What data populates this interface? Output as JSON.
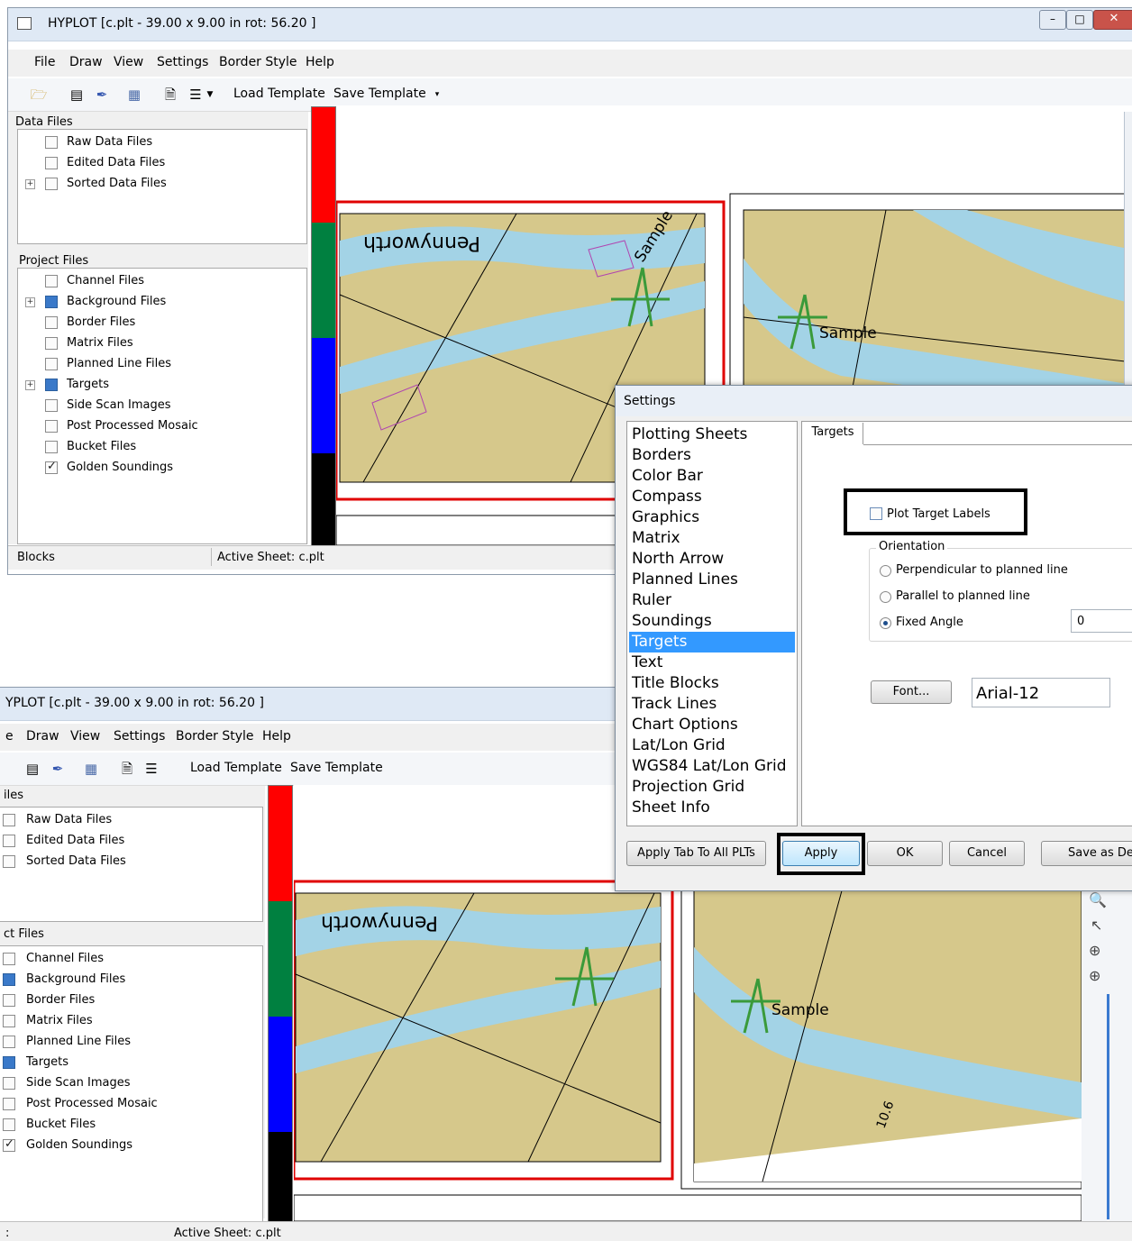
{
  "window": {
    "title": "HYPLOT [c.plt - 39.00 x 9.00 in  rot: 56.20 ]",
    "menu": [
      "File",
      "Draw",
      "View",
      "Settings",
      "Border Style",
      "Help"
    ],
    "toolbar": {
      "load_template": "Load Template",
      "save_template": "Save Template"
    },
    "data_files_title": "Data Files",
    "data_files": [
      "Raw Data Files",
      "Edited Data Files",
      "Sorted Data Files"
    ],
    "project_files_title": "Project Files",
    "project_files": [
      "Channel Files",
      "Background Files",
      "Border Files",
      "Matrix Files",
      "Planned Line Files",
      "Targets",
      "Side Scan Images",
      "Post Processed Mosaic",
      "Bucket Files",
      "Golden Soundings"
    ],
    "status_blocks": "Blocks",
    "status_active_sheet": "Active Sheet: c.plt"
  },
  "window2": {
    "title": "YPLOT [c.plt - 39.00 x 9.00 in  rot: 56.20 ]",
    "menu": [
      "e",
      "Draw",
      "View",
      "Settings",
      "Border Style",
      "Help"
    ],
    "data_files_title": "iles",
    "project_files_title": "ct Files",
    "status_left": ":",
    "status_active_sheet": "Active Sheet: c.plt"
  },
  "map": {
    "label_penny": "Pennyworth",
    "label_sample": "Sample",
    "sounding": "10.6"
  },
  "settings_dialog": {
    "title": "Settings",
    "categories": [
      "Plotting Sheets",
      "Borders",
      "Color Bar",
      "Compass",
      "Graphics",
      "Matrix",
      "North Arrow",
      "Planned Lines",
      "Ruler",
      "Soundings",
      "Targets",
      "Text",
      "Title Blocks",
      "Track Lines",
      "Chart Options",
      "Lat/Lon Grid",
      "WGS84 Lat/Lon Grid",
      "Projection Grid",
      "Sheet Info"
    ],
    "selected_category": "Targets",
    "tab_label": "Targets",
    "plot_target_labels": "Plot Target Labels",
    "orientation_label": "Orientation",
    "orientation_options": [
      "Perpendicular to planned line",
      "Parallel to planned line",
      "Fixed Angle"
    ],
    "orientation_selected": "Fixed Angle",
    "fixed_angle_value": "0",
    "font_button": "Font...",
    "font_value": "Arial-12",
    "buttons": {
      "apply_all": "Apply Tab To All PLTs",
      "apply": "Apply",
      "ok": "OK",
      "cancel": "Cancel",
      "save_default": "Save as De"
    }
  },
  "colors": {
    "colorbar": [
      "#ff0000",
      "#008040",
      "#0000ff",
      "#000000"
    ],
    "water": "#9fd2e6",
    "land": "#d8c98d",
    "accent": "#3399ff"
  }
}
